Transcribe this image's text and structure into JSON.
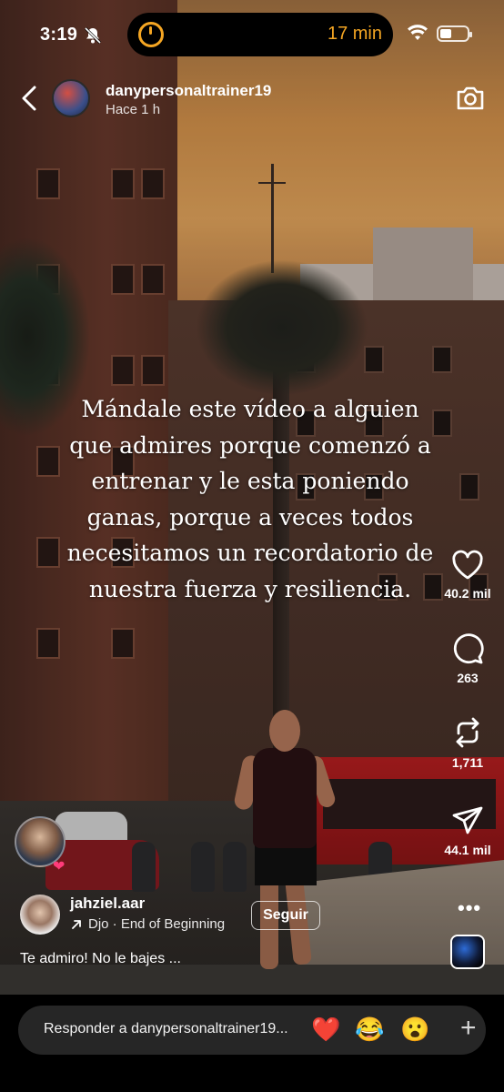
{
  "status_bar": {
    "time": "3:19",
    "timer_minutes": "17 min",
    "icons": [
      "bell-slash-icon",
      "timer-ring-icon",
      "wifi-icon",
      "battery-icon"
    ]
  },
  "header": {
    "username": "danypersonaltrainer19",
    "posted": "Hace 1 h"
  },
  "overlay_text": {
    "lines": [
      "Mándale este vídeo a alguien",
      "que admires porque comenzó a",
      "entrenar y le esta poniendo",
      "ganas, porque a veces todos",
      "necesitamos un recordatorio de",
      "nuestra fuerza y resiliencia."
    ]
  },
  "actions": {
    "likes": "40.2 mil",
    "comments": "263",
    "reposts": "1,711",
    "shares": "44.1 mil"
  },
  "reel": {
    "author": "jahziel.aar",
    "audio": "Djo · End of Beginning",
    "follow_label": "Seguir",
    "caption": "Te admiro! No le bajes ..."
  },
  "reply_bar": {
    "placeholder": "Responder a danypersonaltrainer19...",
    "quick_reactions": [
      "❤️",
      "😂",
      "😮"
    ],
    "plus": "+"
  },
  "colors": {
    "timer_accent": "#f5a623",
    "reply_bg": "#262626"
  }
}
